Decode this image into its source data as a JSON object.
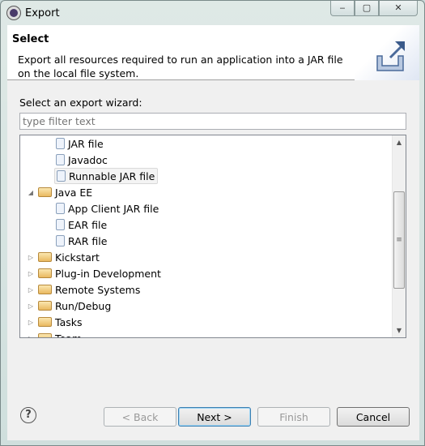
{
  "window": {
    "title": "Export",
    "controls": {
      "minimize": "‒",
      "maximize": "▢",
      "close": "✕"
    }
  },
  "header": {
    "title": "Select",
    "description": "Export all resources required to run an application into a JAR file on the local file system."
  },
  "wizard": {
    "label": "Select an export wizard:",
    "filter_placeholder": "type filter text",
    "filter_value": ""
  },
  "tree": {
    "items": [
      {
        "label": "JAR file",
        "level": 2,
        "type": "file",
        "selected": false
      },
      {
        "label": "Javadoc",
        "level": 2,
        "type": "file",
        "selected": false
      },
      {
        "label": "Runnable JAR file",
        "level": 2,
        "type": "file",
        "selected": true
      },
      {
        "label": "Java EE",
        "level": 1,
        "type": "folder",
        "expanded": true
      },
      {
        "label": "App Client JAR file",
        "level": 2,
        "type": "file"
      },
      {
        "label": "EAR file",
        "level": 2,
        "type": "file"
      },
      {
        "label": "RAR file",
        "level": 2,
        "type": "file"
      },
      {
        "label": "Kickstart",
        "level": 1,
        "type": "folder",
        "expanded": false
      },
      {
        "label": "Plug-in Development",
        "level": 1,
        "type": "folder",
        "expanded": false
      },
      {
        "label": "Remote Systems",
        "level": 1,
        "type": "folder",
        "expanded": false
      },
      {
        "label": "Run/Debug",
        "level": 1,
        "type": "folder",
        "expanded": false
      },
      {
        "label": "Tasks",
        "level": 1,
        "type": "folder",
        "expanded": false
      },
      {
        "label": "Team",
        "level": 1,
        "type": "folder",
        "expanded": false
      }
    ]
  },
  "buttons": {
    "help": "?",
    "back": "< Back",
    "next": "Next >",
    "finish": "Finish",
    "cancel": "Cancel"
  }
}
